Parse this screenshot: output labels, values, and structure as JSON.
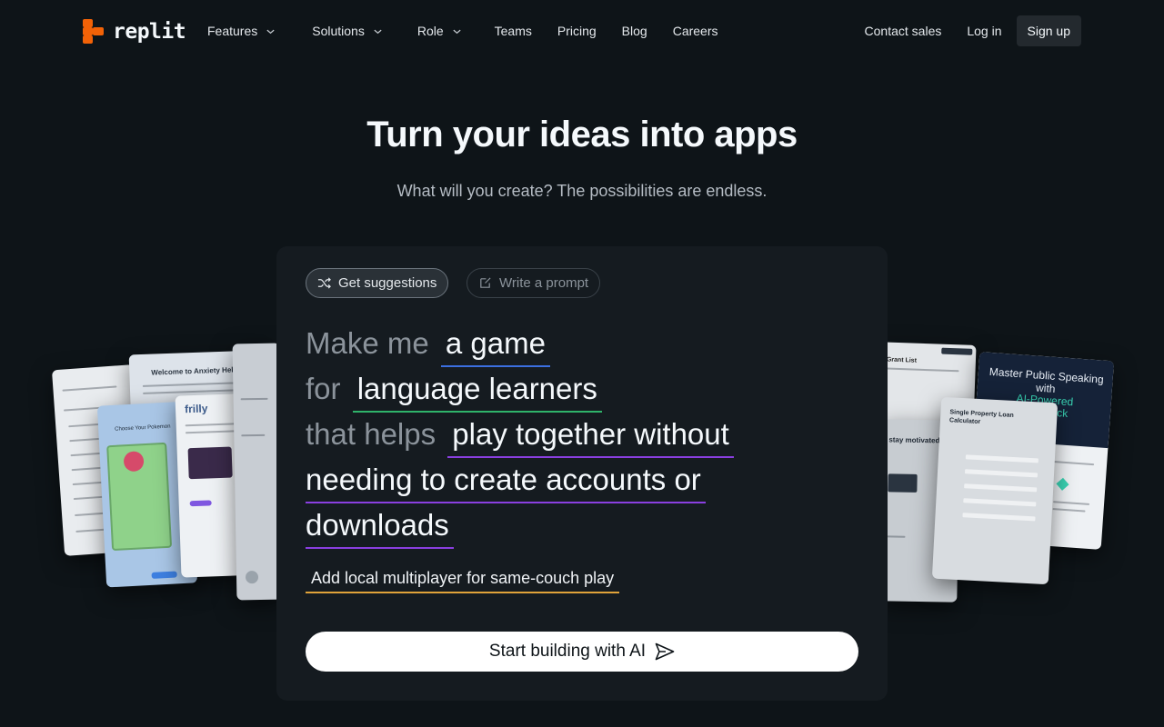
{
  "brand": {
    "name": "replit",
    "accent": "#f26207"
  },
  "nav": {
    "items": [
      {
        "label": "Features",
        "dropdown": true
      },
      {
        "label": "Solutions",
        "dropdown": true
      },
      {
        "label": "Role",
        "dropdown": true
      },
      {
        "label": "Teams",
        "dropdown": false
      },
      {
        "label": "Pricing",
        "dropdown": false
      },
      {
        "label": "Blog",
        "dropdown": false
      },
      {
        "label": "Careers",
        "dropdown": false
      }
    ],
    "contact_sales": "Contact sales",
    "log_in": "Log in",
    "sign_up": "Sign up"
  },
  "hero": {
    "title": "Turn your ideas into apps",
    "subtitle": "What will you create? The possibilities are endless."
  },
  "prompt_panel": {
    "chip_suggestions": "Get suggestions",
    "chip_write": "Write a prompt",
    "line1_lead": "Make me",
    "line1_answer": "a game",
    "line2_lead": "for",
    "line2_answer": "language learners",
    "line3_lead": "that helps",
    "line3_answer": "play together without",
    "line4_answer": "needing to create accounts or",
    "line5_answer": "downloads",
    "suggestion": "Add local multiplayer for same-couch play",
    "cta": "Start building with AI",
    "underline_colors": {
      "what": "#3b6fe0",
      "who": "#2fb36a",
      "how": "#8a3fe0",
      "suggestion": "#e0a33a"
    }
  },
  "showcase": {
    "left_cards": {
      "anxiety_helper_title": "Welcome to Anxiety Helper",
      "pokemon_heading": "Choose Your Pokemon",
      "frilly_logo": "frilly"
    },
    "right_cards": {
      "grant_list_title": "Grant List",
      "loan_calculator_title": "Single Property Loan Calculator",
      "stay_motivated_title": "stay motivated",
      "speaking_title": "Master Public Speaking with",
      "speaking_highlight": "AI-Powered Feedback"
    }
  }
}
